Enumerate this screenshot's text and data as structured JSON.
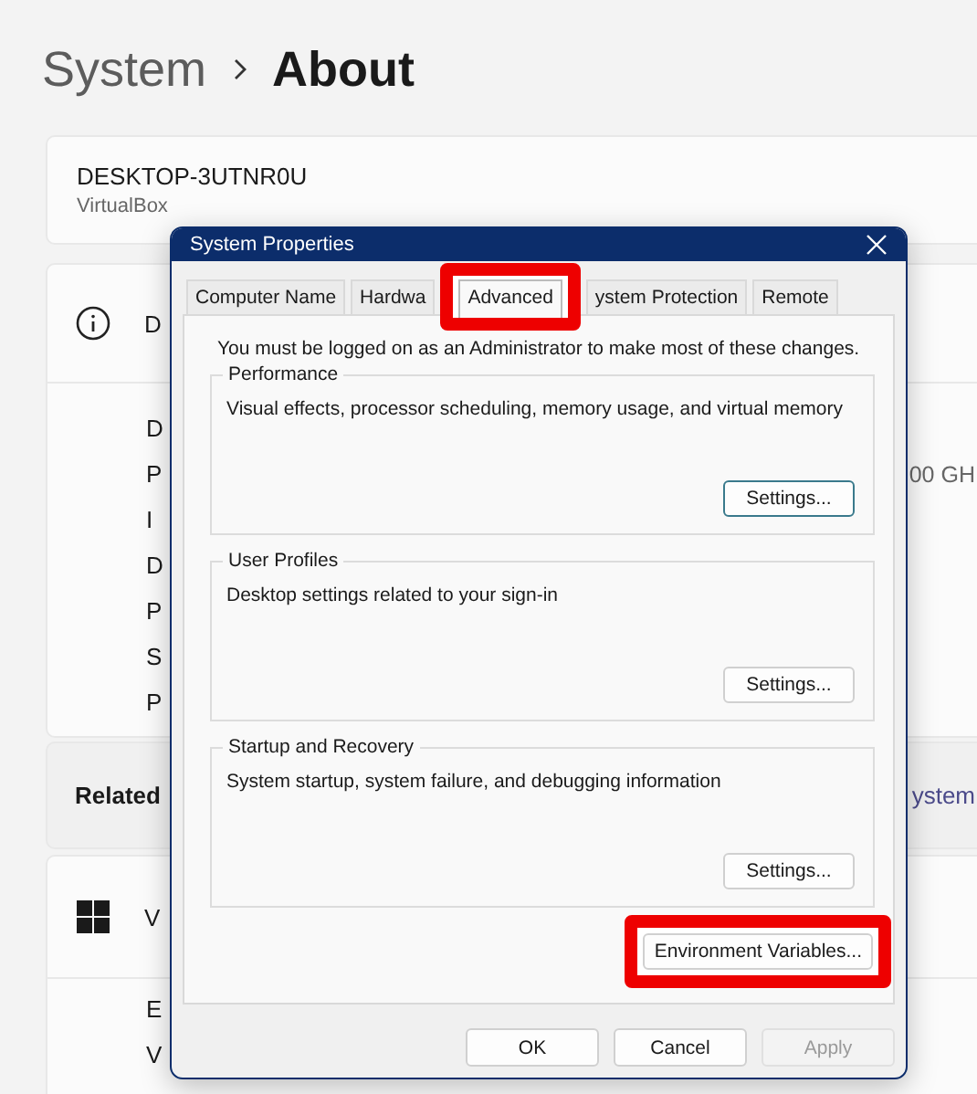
{
  "page": {
    "parent": "System",
    "current": "About",
    "device": {
      "name": "DESKTOP-3UTNR0U",
      "model": "VirtualBox"
    },
    "specs": {
      "heading": "D",
      "rows": [
        {
          "label": "D"
        },
        {
          "label": "P",
          "value": "00 GH"
        },
        {
          "label": "I"
        },
        {
          "label": "D"
        },
        {
          "label": "P"
        },
        {
          "label": "S"
        },
        {
          "label": "P"
        }
      ]
    },
    "related": {
      "label": "Related",
      "link": "ystem"
    },
    "windows_specs": {
      "heading": "V",
      "rows": [
        {
          "label": "E"
        },
        {
          "label": "V"
        }
      ]
    }
  },
  "dialog": {
    "title": "System Properties",
    "tabs": [
      {
        "label": "Computer Name",
        "selected": false,
        "highlighted": false
      },
      {
        "label": "Hardwa",
        "selected": false,
        "highlighted": false
      },
      {
        "label": "Advanced",
        "selected": true,
        "highlighted": true
      },
      {
        "label": "ystem Protection",
        "selected": false,
        "highlighted": false
      },
      {
        "label": "Remote",
        "selected": false,
        "highlighted": false
      }
    ],
    "notice": "You must be logged on as an Administrator to make most of these changes.",
    "groups": [
      {
        "title": "Performance",
        "description": "Visual effects, processor scheduling, memory usage, and virtual memory",
        "button": "Settings...",
        "focused": true
      },
      {
        "title": "User Profiles",
        "description": "Desktop settings related to your sign-in",
        "button": "Settings...",
        "focused": false
      },
      {
        "title": "Startup and Recovery",
        "description": "System startup, system failure, and debugging information",
        "button": "Settings...",
        "focused": false
      }
    ],
    "extra_button": {
      "label": "Environment Variables...",
      "highlighted": true
    },
    "buttons": [
      {
        "label": "OK",
        "disabled": false
      },
      {
        "label": "Cancel",
        "disabled": false
      },
      {
        "label": "Apply",
        "disabled": true
      }
    ]
  }
}
